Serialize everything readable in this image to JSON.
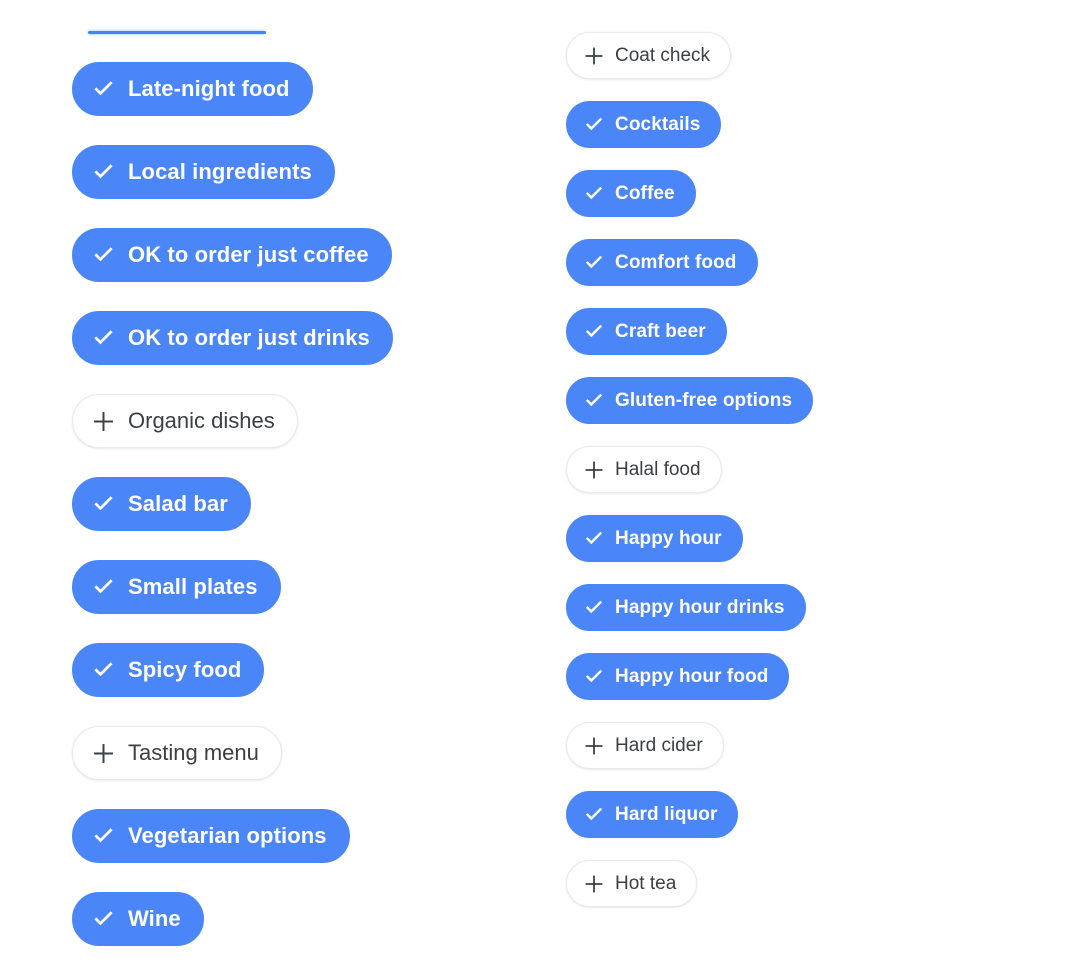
{
  "accent_color": "#4a86f7",
  "selected_text_color": "#ffffff",
  "unselected_text_color": "#3c4043",
  "unselected_border_color": "#e9eaec",
  "background_color": "#ffffff",
  "top_rule": {
    "color": "#4285f4",
    "name": "active-tab-underline"
  },
  "icons": {
    "selected": "check-icon",
    "unselected": "plus-icon"
  },
  "columns": [
    {
      "name": "left-column",
      "chips": [
        {
          "label": "Late-night food",
          "selected": true
        },
        {
          "label": "Local ingredients",
          "selected": true
        },
        {
          "label": "OK to order just coffee",
          "selected": true
        },
        {
          "label": "OK to order just drinks",
          "selected": true
        },
        {
          "label": "Organic dishes",
          "selected": false
        },
        {
          "label": "Salad bar",
          "selected": true
        },
        {
          "label": "Small plates",
          "selected": true
        },
        {
          "label": "Spicy food",
          "selected": true
        },
        {
          "label": "Tasting menu",
          "selected": false
        },
        {
          "label": "Vegetarian options",
          "selected": true
        },
        {
          "label": "Wine",
          "selected": true
        }
      ]
    },
    {
      "name": "right-column",
      "chips": [
        {
          "label": "Coat check",
          "selected": false
        },
        {
          "label": "Cocktails",
          "selected": true
        },
        {
          "label": "Coffee",
          "selected": true
        },
        {
          "label": "Comfort food",
          "selected": true
        },
        {
          "label": "Craft beer",
          "selected": true
        },
        {
          "label": "Gluten-free options",
          "selected": true
        },
        {
          "label": "Halal food",
          "selected": false
        },
        {
          "label": "Happy hour",
          "selected": true
        },
        {
          "label": "Happy hour drinks",
          "selected": true
        },
        {
          "label": "Happy hour food",
          "selected": true
        },
        {
          "label": "Hard cider",
          "selected": false
        },
        {
          "label": "Hard liquor",
          "selected": true
        },
        {
          "label": "Hot tea",
          "selected": false
        }
      ]
    }
  ]
}
